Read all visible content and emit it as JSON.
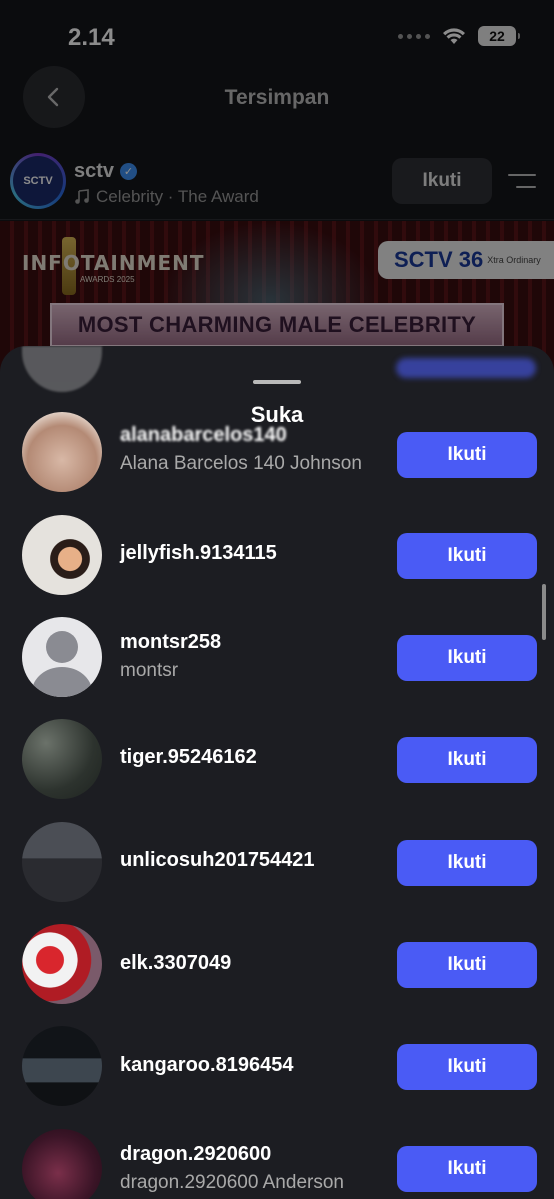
{
  "status_bar": {
    "time": "2.14",
    "battery": "22"
  },
  "header": {
    "title": "Tersimpan"
  },
  "profile": {
    "name": "sctv",
    "subtitle": "Celebrity · The Award",
    "follow_label": "Ikuti",
    "avatar_text": "SCTV"
  },
  "banner": {
    "left_logo": "INFOTAINMENT",
    "left_logo_sub": "AWARDS 2025",
    "right_logo": "SCTV 36",
    "right_logo_sub": "Xtra Ordinary",
    "ribbon": "MOST CHARMING MALE CELEBRITY"
  },
  "sheet": {
    "title": "Suka",
    "users": [
      {
        "username": "alanabarcelos140",
        "name": "Alana Barcelos 140 Johnson",
        "button": "Ikuti"
      },
      {
        "username": "jellyfish.9134115",
        "name": "",
        "button": "Ikuti"
      },
      {
        "username": "montsr258",
        "name": "montsr",
        "button": "Ikuti"
      },
      {
        "username": "tiger.95246162",
        "name": "",
        "button": "Ikuti"
      },
      {
        "username": "unlicosuh201754421",
        "name": "",
        "button": "Ikuti"
      },
      {
        "username": "elk.3307049",
        "name": "",
        "button": "Ikuti"
      },
      {
        "username": "kangaroo.8196454",
        "name": "",
        "button": "Ikuti"
      },
      {
        "username": "dragon.2920600",
        "name": "dragon.2920600 Anderson",
        "button": "Ikuti"
      }
    ]
  },
  "colors": {
    "accent": "#4a5bf5",
    "sheet_bg": "#1c1d22",
    "verified": "#3d8ef0"
  }
}
